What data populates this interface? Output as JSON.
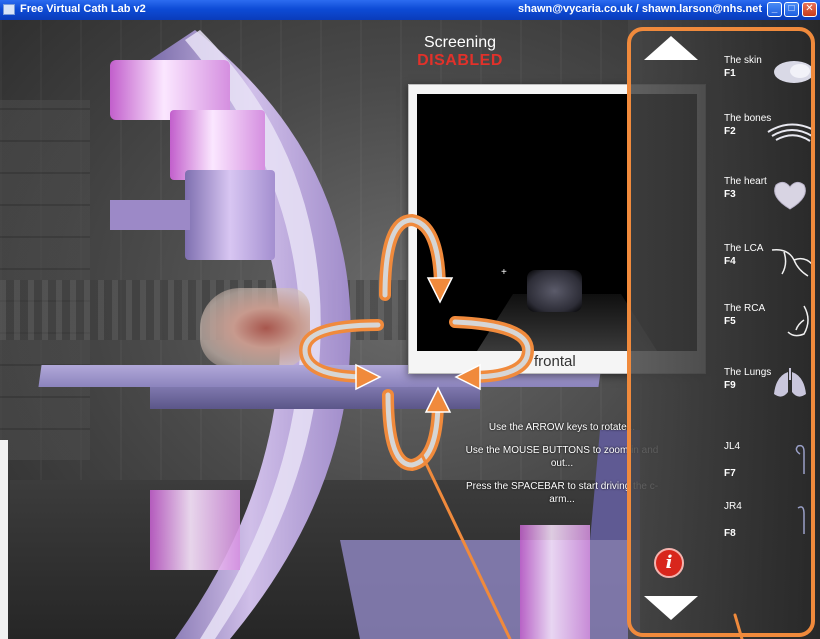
{
  "window": {
    "title": "Free Virtual Cath Lab v2",
    "emails": "shawn@vycaria.co.uk / shawn.larson@nhs.net"
  },
  "screening": {
    "label": "Screening",
    "status": "DISABLED",
    "status_color": "#e2312a"
  },
  "monitor": {
    "view_label": "frontal"
  },
  "instructions": [
    "Use the ARROW keys to rotate...",
    "Use the MOUSE BUTTONS to zoom in and out...",
    "Press the SPACEBAR to start driving the c-arm..."
  ],
  "panel": {
    "accent_color": "#f08a3c",
    "scroll_up_icon": "triangle-up-icon",
    "scroll_down_icon": "triangle-down-icon",
    "info_icon": "info-icon",
    "items": [
      {
        "name": "The skin",
        "key": "F1",
        "icon": "skin-thumbnail"
      },
      {
        "name": "The bones",
        "key": "F2",
        "icon": "bones-thumbnail"
      },
      {
        "name": "The heart",
        "key": "F3",
        "icon": "heart-thumbnail"
      },
      {
        "name": "The LCA",
        "key": "F4",
        "icon": "lca-thumbnail"
      },
      {
        "name": "The RCA",
        "key": "F5",
        "icon": "rca-thumbnail"
      },
      {
        "name": "The Lungs",
        "key": "F9",
        "icon": "lungs-thumbnail"
      },
      {
        "name": "JL4",
        "key": "F7",
        "icon": "catheter-jl4-thumbnail"
      },
      {
        "name": "JR4",
        "key": "F8",
        "icon": "catheter-jr4-thumbnail"
      }
    ]
  },
  "overlay": {
    "arrow_color": "#f08a3c",
    "arrows": "rotate-arrows-icon"
  }
}
